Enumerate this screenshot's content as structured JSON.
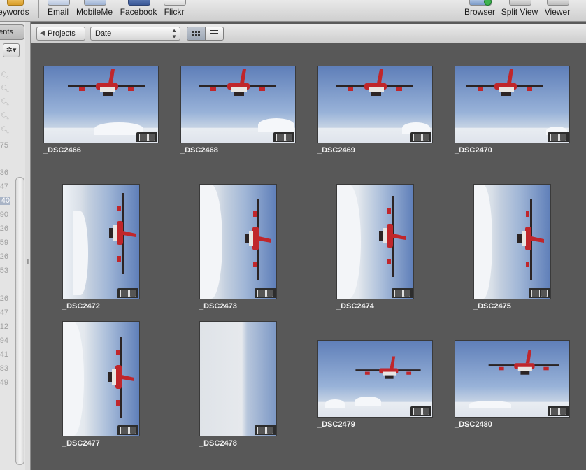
{
  "toolbar": {
    "left_items": [
      {
        "label": "eywords",
        "icon": "keywords-icon"
      },
      {
        "label": "Email",
        "icon": "email-icon"
      },
      {
        "label": "MobileMe",
        "icon": "mobileme-icon"
      },
      {
        "label": "Facebook",
        "icon": "facebook-icon"
      },
      {
        "label": "Flickr",
        "icon": "flickr-icon"
      }
    ],
    "right_items": [
      {
        "label": "Browser",
        "icon": "browser-icon"
      },
      {
        "label": "Split View",
        "icon": "split-view-icon"
      },
      {
        "label": "Viewer",
        "icon": "viewer-icon"
      }
    ]
  },
  "sidebar": {
    "tab_label": "nents",
    "gear_glyph": "✲▾",
    "counts": [
      "36",
      "47",
      "40",
      "90",
      "26",
      "59",
      "26",
      "53",
      "26",
      "47",
      "12",
      "94",
      "41",
      "83",
      "49"
    ],
    "first_count": "75",
    "selected_count": "40"
  },
  "subbar": {
    "projects_label": "Projects",
    "sort_value": "Date",
    "view_modes": [
      "grid",
      "list"
    ]
  },
  "photos": [
    {
      "name": "_DSC2466"
    },
    {
      "name": "_DSC2468"
    },
    {
      "name": "_DSC2469"
    },
    {
      "name": "_DSC2470"
    },
    {
      "name": "_DSC2472"
    },
    {
      "name": "_DSC2473"
    },
    {
      "name": "_DSC2474"
    },
    {
      "name": "_DSC2475"
    },
    {
      "name": "_DSC2477"
    },
    {
      "name": "_DSC2478"
    },
    {
      "name": "_DSC2479"
    },
    {
      "name": "_DSC2480"
    }
  ],
  "colors": {
    "grid_background": "#585858",
    "aircraft_red": "#c0262b",
    "sky_blue": "#5f7fb9"
  }
}
